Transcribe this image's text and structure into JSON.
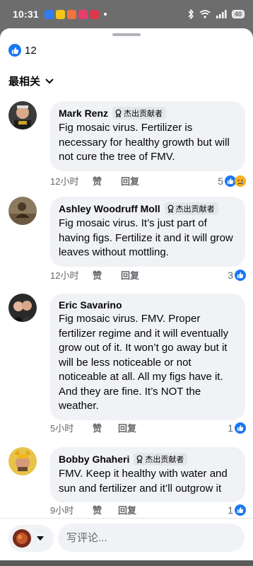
{
  "status": {
    "time": "10:31",
    "battery": "40"
  },
  "reactions_summary": {
    "count": "12"
  },
  "sort": {
    "label": "最相关"
  },
  "badge_label": "杰出贡献者",
  "comments": [
    {
      "author": "Mark Renz",
      "badge": true,
      "text": "Fig mosaic virus. Fertilizer is necessary for healthy growth but will not cure the tree of FMV.",
      "time": "12小时",
      "like": "赞",
      "reply": "回复",
      "reactions": "5"
    },
    {
      "author": "Ashley Woodruff Moll",
      "badge": true,
      "text": "Fig mosaic virus. It’s just part of having figs. Fertilize it and it will grow leaves without mottling.",
      "time": "12小时",
      "like": "赞",
      "reply": "回复",
      "reactions": "3"
    },
    {
      "author": "Eric Savarino",
      "badge": false,
      "text": "Fig mosaic virus. FMV. Proper fertilizer regime and it will eventually grow out of it. It won’t go away but it will be less noticeable or not noticeable at all. All my figs have it. And they are fine. It’s NOT the weather.",
      "time": "5小时",
      "like": "赞",
      "reply": "回复",
      "reactions": "1"
    },
    {
      "author": "Bobby Ghaheri",
      "badge": true,
      "text": "FMV. Keep it healthy with water and sun and fertilizer and it’ll outgrow it",
      "time": "9小时",
      "like": "赞",
      "reply": "回复",
      "reactions": "1"
    }
  ],
  "composer": {
    "placeholder": "写评论..."
  },
  "colors": {
    "accent": "#1877f2",
    "bubble": "#f0f2f5",
    "muted": "#65676b"
  }
}
